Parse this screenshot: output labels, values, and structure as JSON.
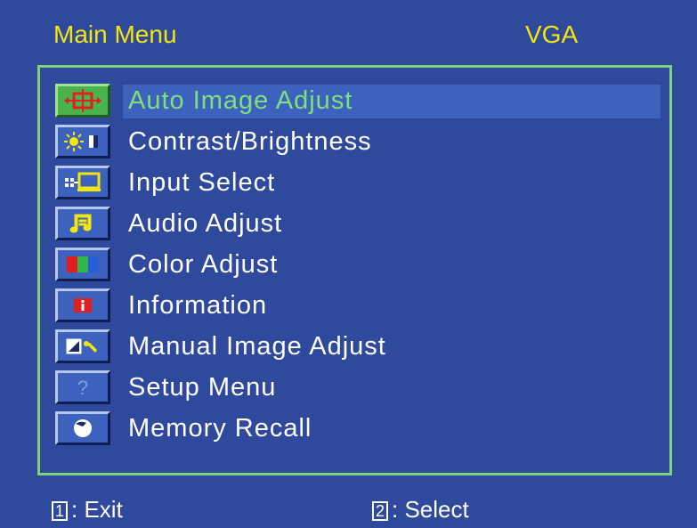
{
  "header": {
    "title": "Main Menu",
    "input_mode": "VGA"
  },
  "menu": {
    "items": [
      {
        "label": "Auto Image Adjust",
        "icon": "auto-adjust-icon",
        "selected": true
      },
      {
        "label": "Contrast/Brightness",
        "icon": "contrast-brightness-icon",
        "selected": false
      },
      {
        "label": "Input Select",
        "icon": "input-select-icon",
        "selected": false
      },
      {
        "label": "Audio Adjust",
        "icon": "audio-icon",
        "selected": false
      },
      {
        "label": "Color Adjust",
        "icon": "color-icon",
        "selected": false
      },
      {
        "label": "Information",
        "icon": "information-icon",
        "selected": false
      },
      {
        "label": "Manual Image Adjust",
        "icon": "manual-adjust-icon",
        "selected": false
      },
      {
        "label": "Setup Menu",
        "icon": "setup-icon",
        "selected": false
      },
      {
        "label": "Memory Recall",
        "icon": "memory-recall-icon",
        "selected": false
      }
    ]
  },
  "footer": {
    "exit_key": "1",
    "exit_label": ": Exit",
    "select_key": "2",
    "select_label": ": Select"
  },
  "colors": {
    "background": "#2f4a9c",
    "header_text": "#f3e60f",
    "frame": "#7fd27a",
    "selected_text": "#7ee07b",
    "highlight": "#3d62be"
  }
}
